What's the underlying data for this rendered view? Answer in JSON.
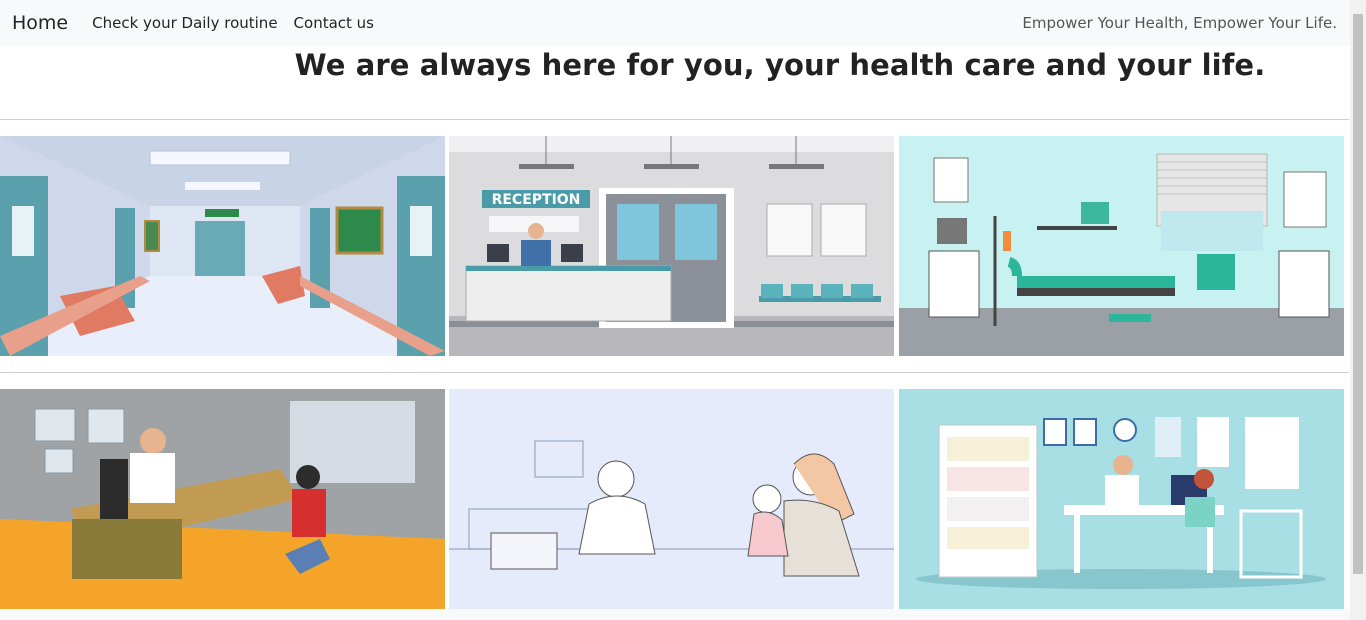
{
  "navbar": {
    "brand": "Home",
    "links": [
      "Check your Daily routine",
      "Contact us"
    ],
    "tagline": "Empower Your Health, Empower Your Life."
  },
  "hero": {
    "title": "We are always here for you, your health care and your life."
  },
  "gallery": {
    "images": [
      {
        "name": "hospital-corridor-illustration"
      },
      {
        "name": "reception-illustration",
        "sign": "RECEPTION"
      },
      {
        "name": "hospital-ward-illustration"
      },
      {
        "name": "doctor-consultation-illustration"
      },
      {
        "name": "doctor-mother-child-sketch-illustration"
      },
      {
        "name": "doctor-office-illustration"
      }
    ]
  },
  "colors": {
    "navbar_bg": "#f8f9fa",
    "teal": "#5aa9b3",
    "background": "#ffffff"
  }
}
